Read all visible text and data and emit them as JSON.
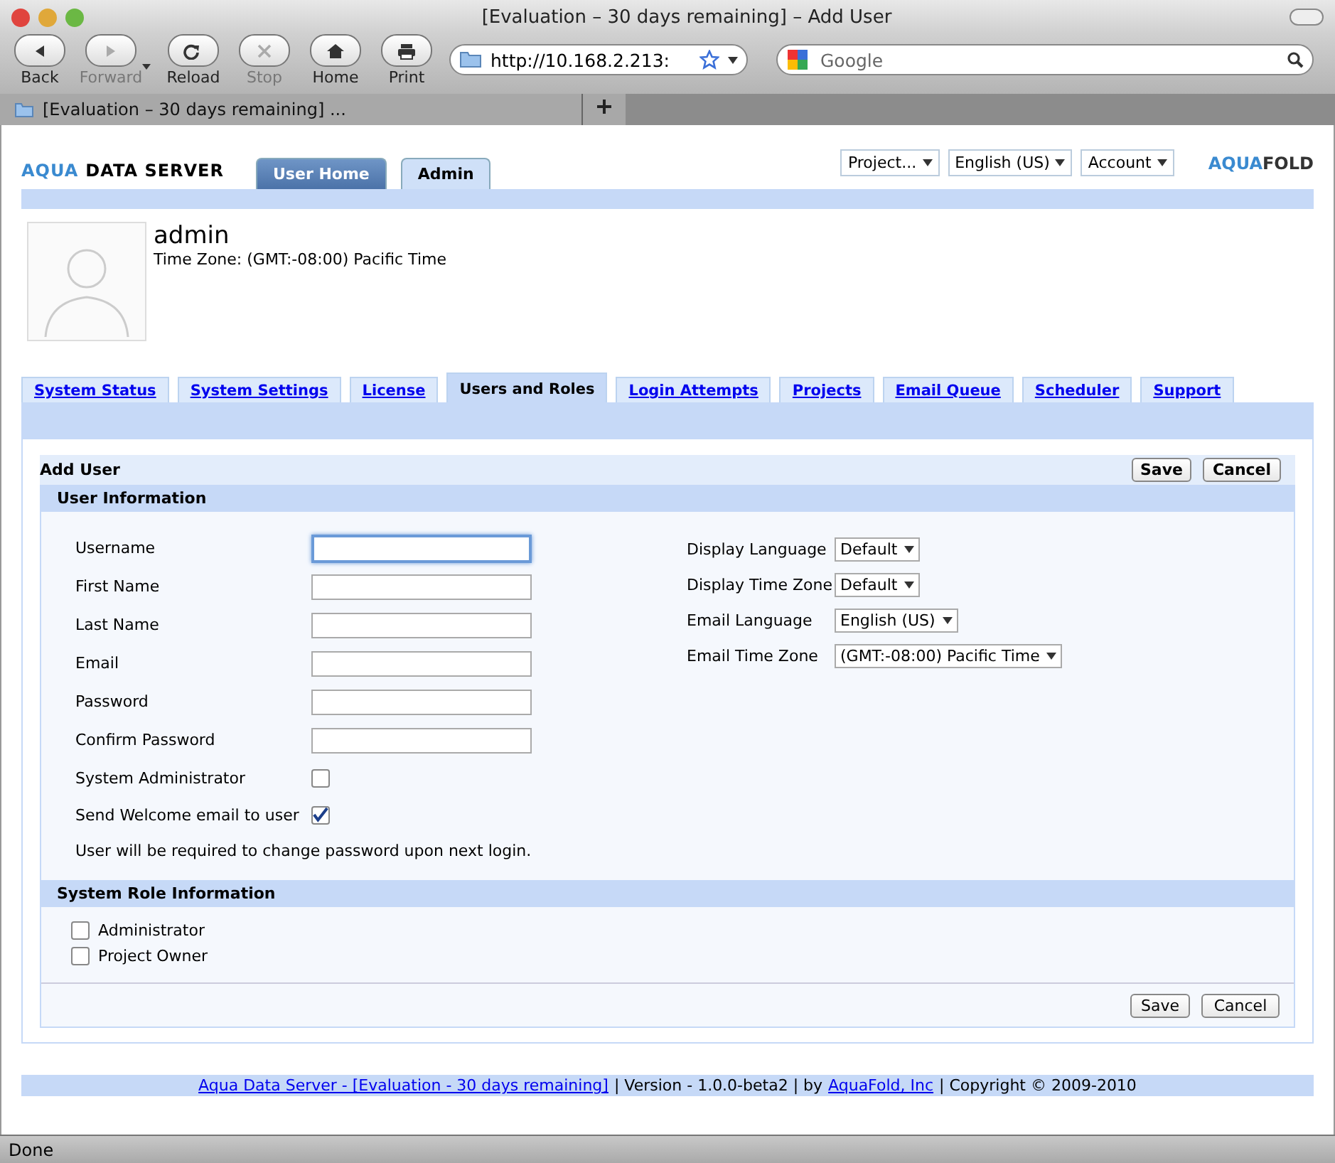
{
  "window": {
    "title": "[Evaluation – 30 days remaining] – Add User"
  },
  "toolbar": {
    "buttons": [
      {
        "kind": "back",
        "label": "Back",
        "disabled": false
      },
      {
        "kind": "forward",
        "label": "Forward",
        "disabled": true
      },
      {
        "kind": "reload",
        "label": "Reload",
        "disabled": false
      },
      {
        "kind": "stop",
        "label": "Stop",
        "disabled": true
      },
      {
        "kind": "home",
        "label": "Home",
        "disabled": false
      },
      {
        "kind": "print",
        "label": "Print",
        "disabled": false
      }
    ],
    "address": "http://10.168.2.213:",
    "search_placeholder": "Google"
  },
  "browser_tabs": [
    {
      "title": "[Evaluation – 30 days remaining] ..."
    }
  ],
  "header": {
    "logo": {
      "accent": "AQUA",
      "rest": "DATA SERVER"
    },
    "nav_tabs": [
      {
        "label": "User Home",
        "selected": false
      },
      {
        "label": "Admin",
        "selected": true
      }
    ],
    "menus": [
      "Project...",
      "English (US)",
      "Account"
    ],
    "brand": {
      "accent": "AQUA",
      "rest": "FOLD"
    }
  },
  "profile": {
    "name": "admin",
    "time_zone": "Time Zone: (GMT:-08:00) Pacific Time"
  },
  "admin_tabs": [
    {
      "label": "System Status",
      "selected": false
    },
    {
      "label": "System Settings",
      "selected": false
    },
    {
      "label": "License",
      "selected": false
    },
    {
      "label": "Users and Roles",
      "selected": true
    },
    {
      "label": "Login Attempts",
      "selected": false
    },
    {
      "label": "Projects",
      "selected": false
    },
    {
      "label": "Email Queue",
      "selected": false
    },
    {
      "label": "Scheduler",
      "selected": false
    },
    {
      "label": "Support",
      "selected": false
    }
  ],
  "panel": {
    "title": "Add User",
    "buttons": [
      "Save",
      "Cancel"
    ],
    "user_section": {
      "title": "User Information",
      "fields": [
        {
          "kind": "text",
          "label": "Username",
          "focused": true
        },
        {
          "kind": "text",
          "label": "First Name",
          "focused": false
        },
        {
          "kind": "text",
          "label": "Last Name",
          "focused": false
        },
        {
          "kind": "text",
          "label": "Email",
          "focused": false
        },
        {
          "kind": "text",
          "label": "Password",
          "focused": false
        },
        {
          "kind": "text",
          "label": "Confirm Password",
          "focused": false
        },
        {
          "kind": "checkbox",
          "label": "System Administrator",
          "checked": false
        },
        {
          "kind": "checkbox",
          "label": "Send Welcome email to user",
          "checked": true
        }
      ],
      "note": "User will be required to change password upon next login.",
      "settings": [
        {
          "label": "Display Language",
          "value": "Default"
        },
        {
          "label": "Display Time Zone",
          "value": "Default"
        },
        {
          "label": "Email Language",
          "value": "English (US)"
        },
        {
          "label": "Email Time Zone",
          "value": "(GMT:-08:00) Pacific Time"
        }
      ]
    },
    "role_section": {
      "title": "System Role Information",
      "roles": [
        {
          "label": "Administrator",
          "checked": false
        },
        {
          "label": "Project Owner",
          "checked": false
        }
      ]
    },
    "bottom_buttons": [
      "Save",
      "Cancel"
    ]
  },
  "footer": [
    {
      "kind": "link",
      "text": "Aqua Data Server - [Evaluation - 30 days remaining]"
    },
    {
      "kind": "text",
      "text": "| Version - 1.0.0-beta2 | by"
    },
    {
      "kind": "link",
      "text": "AquaFold, Inc"
    },
    {
      "kind": "text",
      "text": "| Copyright © 2009-2010"
    }
  ],
  "status_bar": {
    "text": "Done"
  }
}
